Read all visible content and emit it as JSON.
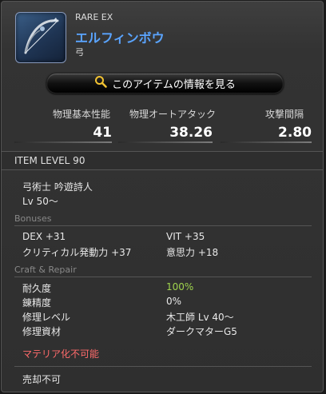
{
  "item": {
    "rarity": "RARE EX",
    "name": "エルフィンボウ",
    "type": "弓",
    "icon": "bow-icon"
  },
  "info_button": {
    "label": "このアイテムの情報を見る",
    "icon": "magnifier-icon"
  },
  "stats": [
    {
      "label": "物理基本性能",
      "value": "41"
    },
    {
      "label": "物理オートアタック",
      "value": "38.26"
    },
    {
      "label": "攻撃間隔",
      "value": "2.80"
    }
  ],
  "item_level": "ITEM LEVEL 90",
  "jobs": "弓術士 吟遊詩人",
  "level_req": "Lv 50〜",
  "bonuses": {
    "title": "Bonuses",
    "items": [
      "DEX +31",
      "VIT +35",
      "クリティカル発動力 +37",
      "意思力 +18"
    ]
  },
  "craft": {
    "title": "Craft & Repair",
    "rows": [
      {
        "label": "耐久度",
        "value": "100%"
      },
      {
        "label": "錬精度",
        "value": "0%"
      },
      {
        "label": "修理レベル",
        "value": "木工師 Lv 40〜"
      },
      {
        "label": "修理資材",
        "value": "ダークマターG5"
      }
    ]
  },
  "materia_note": "マテリア化不可能",
  "sell_note": "売却不可",
  "colors": {
    "name": "#5aa4ff",
    "durability": "#9fd44d",
    "warning": "#ff6b6b"
  }
}
